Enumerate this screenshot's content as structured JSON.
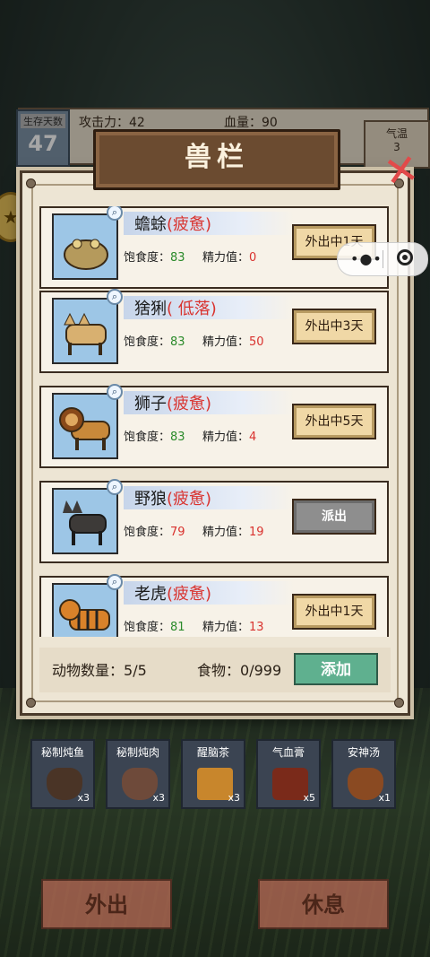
{
  "hud": {
    "days_label": "生存天数",
    "days_value": "47",
    "attack": "攻击力：42",
    "hp": "血量：90",
    "temp_label": "气温",
    "temp_value": "3"
  },
  "panel": {
    "title": "兽栏",
    "close_icon": "close-x-icon"
  },
  "labels": {
    "satiety": "饱食度：",
    "energy": "精力值："
  },
  "animals": [
    {
      "name": "蟾蜍",
      "status": "(疲惫)",
      "satiety": "83",
      "energy": "0",
      "button": "外出中1天",
      "button_type": "away",
      "thumb_color": "#9fc8e8",
      "body_color": "#b59a5c"
    },
    {
      "name": "猞猁",
      "status": "( 低落)",
      "satiety": "83",
      "energy": "50",
      "button": "外出中3天",
      "button_type": "away",
      "thumb_color": "#9fc8e8",
      "body_color": "#d8b070"
    },
    {
      "name": "狮子",
      "status": "(疲惫)",
      "satiety": "83",
      "energy": "4",
      "button": "外出中5天",
      "button_type": "away",
      "thumb_color": "#9fc8e8",
      "body_color": "#c9893a"
    },
    {
      "name": "野狼",
      "status": "(疲惫)",
      "satiety": "79",
      "energy": "19",
      "button": "派出",
      "button_type": "send",
      "thumb_color": "#9fc8e8",
      "body_color": "#3d3a38"
    },
    {
      "name": "老虎",
      "status": "(疲惫)",
      "satiety": "81",
      "energy": "13",
      "button": "外出中1天",
      "button_type": "away",
      "thumb_color": "#9fc8e8",
      "body_color": "#d9822a"
    }
  ],
  "footer": {
    "count_label": "动物数量：",
    "count_value": "5/5",
    "food_label": "食物：",
    "food_value": "0/999",
    "add_button": "添加"
  },
  "items": [
    {
      "label": "秘制炖鱼",
      "count": "x3",
      "color": "#4a3426"
    },
    {
      "label": "秘制炖肉",
      "count": "x3",
      "color": "#6e4a3a"
    },
    {
      "label": "醒脑茶",
      "count": "x3",
      "color": "#c8862c"
    },
    {
      "label": "气血膏",
      "count": "x5",
      "color": "#7a2a1a"
    },
    {
      "label": "安神汤",
      "count": "x1",
      "color": "#8a4a22"
    }
  ],
  "actions": {
    "go_out": "外出",
    "rest": "休息"
  }
}
